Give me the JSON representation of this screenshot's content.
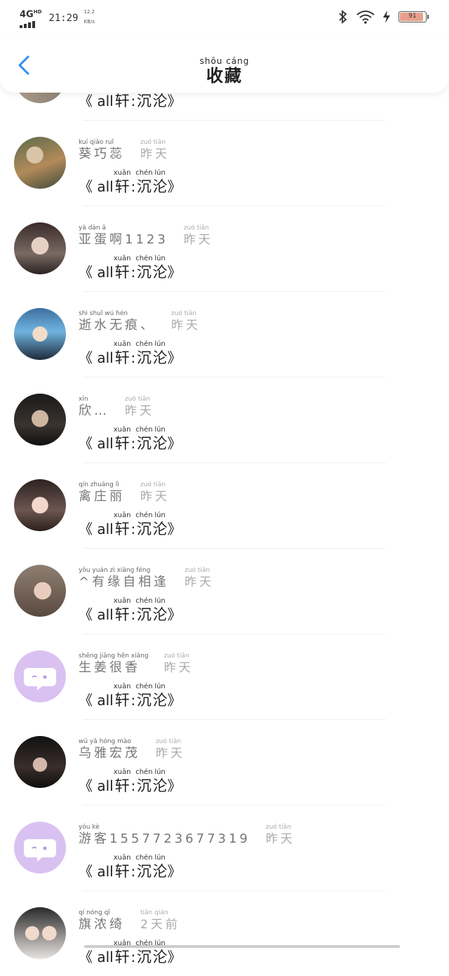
{
  "status_bar": {
    "network": "4G",
    "network_sup": "HD",
    "time": "21:29",
    "speed_value": "12.2",
    "speed_unit": "KB/s",
    "battery": "91",
    "battery_level": 0.91
  },
  "header": {
    "title_pinyin": "shōu cáng",
    "title": "收藏"
  },
  "post_title": {
    "open": "《 all",
    "xuan_pinyin": "xuān",
    "xuan": "轩",
    "colon": " : ",
    "chen_pinyin": "chén",
    "chen": "沉",
    "lun_pinyin": "lún",
    "lun": "沦",
    "close": " 》"
  },
  "items": [
    {
      "name_pinyin": "kuí qiǎo ruǐ",
      "name": "葵巧蕊",
      "time_pinyin": "zuó tiān",
      "time": "昨天",
      "avatar": "photo-shop"
    },
    {
      "name_pinyin": "yà dàn ā",
      "name": "亚蛋啊1123",
      "time_pinyin": "zuó tiān",
      "time": "昨天",
      "avatar": "anime-man"
    },
    {
      "name_pinyin": "shì shuǐ wú hén",
      "name": "逝水无痕、",
      "time_pinyin": "zuó tiān",
      "time": "昨天",
      "avatar": "anime-blue"
    },
    {
      "name_pinyin": "xīn",
      "name": "欣…",
      "time_pinyin": "zuó tiān",
      "time": "昨天",
      "avatar": "man-dark"
    },
    {
      "name_pinyin": "qín zhuāng lì",
      "name": "禽庄丽",
      "time_pinyin": "zuó tiān",
      "time": "昨天",
      "avatar": "girl"
    },
    {
      "name_pinyin": "yǒu yuán zì xiāng féng",
      "name": "^有缘自相逢",
      "time_pinyin": "zuó tiān",
      "time": "昨天",
      "avatar": "glasses"
    },
    {
      "name_pinyin": "shēng jiāng hěn xiāng",
      "name": "生姜很香",
      "time_pinyin": "zuó tiān",
      "time": "昨天",
      "avatar": "default"
    },
    {
      "name_pinyin": "wū yǎ hóng mào",
      "name": "乌雅宏茂",
      "time_pinyin": "zuó tiān",
      "time": "昨天",
      "avatar": "boy-dark"
    },
    {
      "name_pinyin": "yóu kè",
      "name": "游客1557723677319",
      "time_pinyin": "zuó tiān",
      "time": "昨天",
      "avatar": "default"
    },
    {
      "name_pinyin": "qí nóng qī",
      "name": "旗浓绮",
      "time_pinyin": "tiān qián",
      "time": "2天前",
      "avatar": "kids"
    }
  ],
  "colors": {
    "accent": "#2f8ff5",
    "default_avatar": "#d9c2f2",
    "muted_text": "#aaaaaa"
  }
}
